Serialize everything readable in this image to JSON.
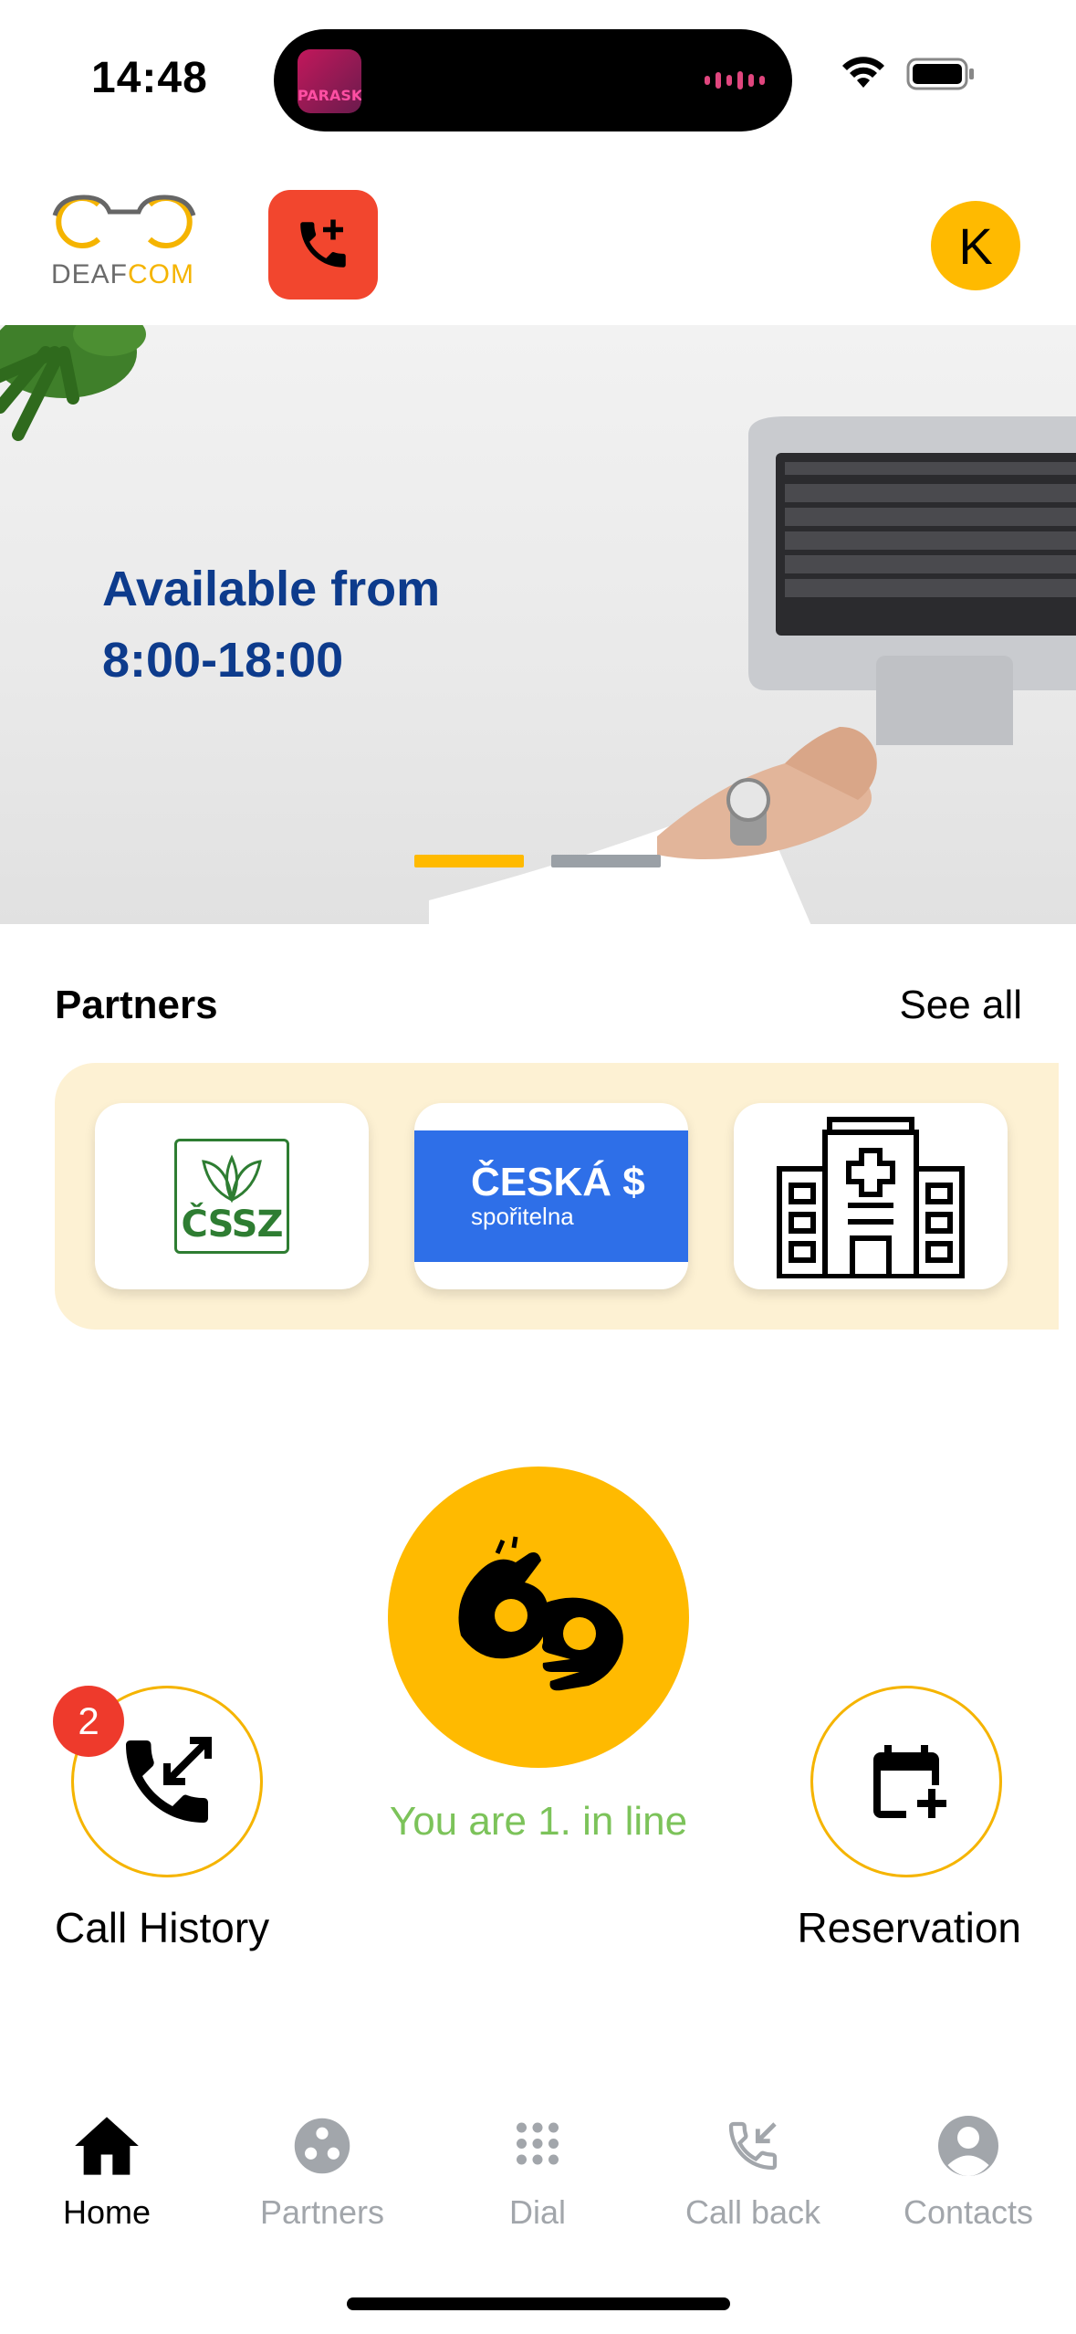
{
  "status_bar": {
    "time": "14:48",
    "island_app_text": "PARASK",
    "icons": [
      "wifi-icon",
      "battery-icon"
    ]
  },
  "header": {
    "logo_part1": "DEAF",
    "logo_part2": "COM",
    "new_call_icon": "phone-plus-icon",
    "avatar_initial": "K"
  },
  "banner": {
    "line1": "Available from",
    "line2": "8:00-18:00",
    "pages": 2,
    "active_page": 1
  },
  "partners": {
    "title": "Partners",
    "see_all": "See all",
    "items": [
      {
        "name": "ČSSZ"
      },
      {
        "name_line1": "ČESKÁ",
        "name_line2": "spořitelna"
      },
      {
        "icon": "hospital-icon"
      }
    ]
  },
  "main": {
    "interpreter_icon": "sign-language-icon",
    "queue_status": "You are 1. in line",
    "call_history_label": "Call History",
    "call_history_badge": "2",
    "reservation_label": "Reservation"
  },
  "tabs": [
    {
      "label": "Home",
      "icon": "home-icon",
      "active": true
    },
    {
      "label": "Partners",
      "icon": "partners-icon",
      "active": false
    },
    {
      "label": "Dial",
      "icon": "dialpad-icon",
      "active": false
    },
    {
      "label": "Call back",
      "icon": "call-back-icon",
      "active": false
    },
    {
      "label": "Contacts",
      "icon": "contact-icon",
      "active": false
    }
  ],
  "colors": {
    "accent": "#ffba00",
    "call_button": "#f2462e",
    "banner_text": "#0d3b8c",
    "queue_text": "#7cc35a",
    "badge": "#ee3a2c",
    "partners_bg": "#fdf1d3",
    "inactive_tab": "#a2a6ab"
  }
}
